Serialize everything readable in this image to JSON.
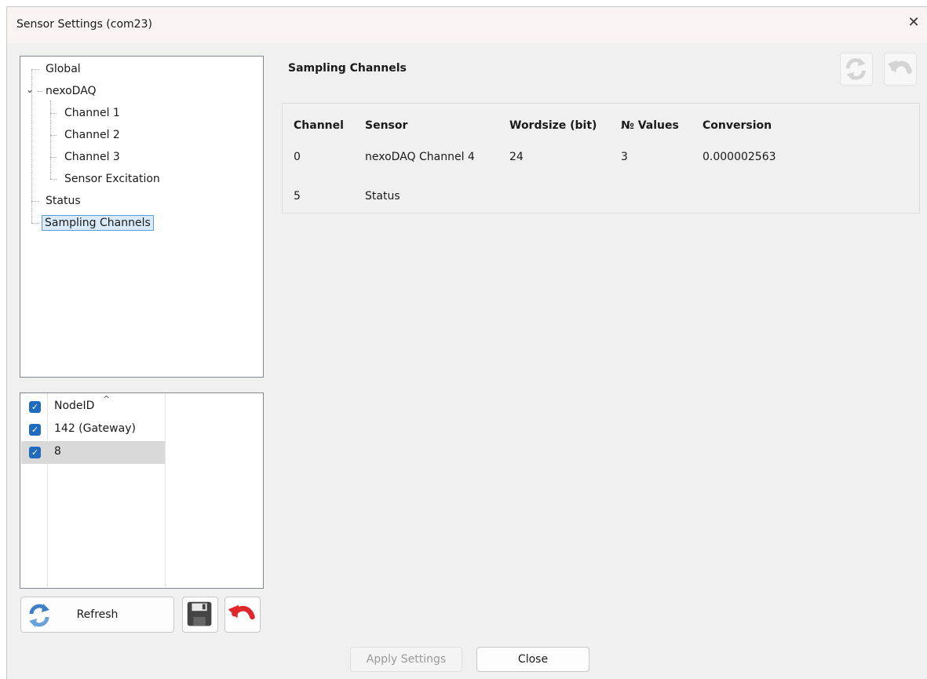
{
  "window": {
    "title": "Sensor Settings (com23)"
  },
  "tree": {
    "items": [
      {
        "label": "Global"
      },
      {
        "label": "nexoDAQ"
      },
      {
        "label": "Channel 1"
      },
      {
        "label": "Channel 2"
      },
      {
        "label": "Channel 3"
      },
      {
        "label": "Sensor Excitation"
      },
      {
        "label": "Status"
      },
      {
        "label": "Sampling Channels",
        "selected": true
      }
    ]
  },
  "nodes": {
    "header": "NodeID",
    "rows": [
      {
        "label": "142 (Gateway)",
        "checked": true
      },
      {
        "label": "8",
        "checked": true,
        "selected": true
      }
    ]
  },
  "buttons": {
    "refresh": "Refresh",
    "apply": "Apply Settings",
    "close": "Close"
  },
  "main": {
    "title": "Sampling Channels",
    "table": {
      "headers": [
        "Channel",
        "Sensor",
        "Wordsize (bit)",
        "№ Values",
        "Conversion"
      ],
      "rows": [
        [
          "0",
          "nexoDAQ Channel 4",
          "24",
          "3",
          "0.000002563"
        ],
        [
          "5",
          "Status",
          "",
          "",
          ""
        ]
      ]
    }
  },
  "colors": {
    "accent": "#1f6cbf",
    "selection": "#d9ebf9",
    "refresh_blue": "#3f7fc8",
    "undo_red": "#e0262a"
  },
  "icons": [
    "close-icon",
    "refresh-icon",
    "save-icon",
    "undo-icon",
    "checkbox-icon",
    "chevron-down-icon",
    "sort-up-icon"
  ]
}
